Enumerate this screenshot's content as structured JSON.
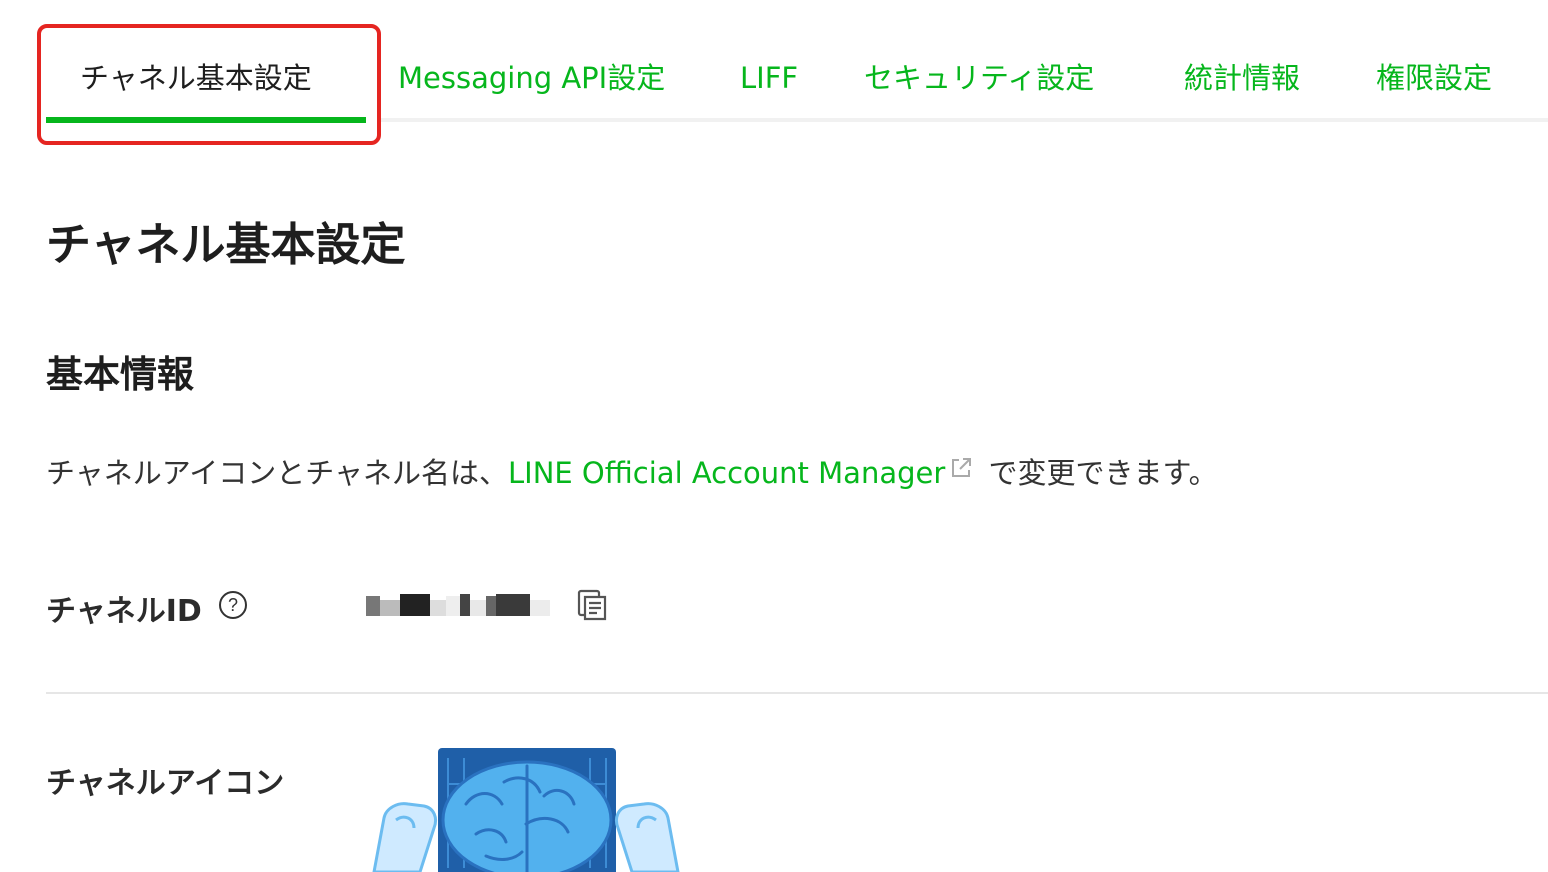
{
  "tabs": [
    {
      "label": "チャネル基本設定",
      "active": true
    },
    {
      "label": "Messaging API設定",
      "active": false
    },
    {
      "label": "LIFF",
      "active": false
    },
    {
      "label": "セキュリティ設定",
      "active": false
    },
    {
      "label": "統計情報",
      "active": false
    },
    {
      "label": "権限設定",
      "active": false
    }
  ],
  "page_title": "チャネル基本設定",
  "section_title": "基本情報",
  "description": {
    "before": "チャネルアイコンとチャネル名は、",
    "link_text": "LINE Official Account Manager",
    "after": " で変更できます。"
  },
  "fields": {
    "channel_id_label": "チャネルID",
    "channel_icon_label": "チャネルアイコン"
  },
  "icons": [
    "help-circle-icon",
    "copy-icon",
    "external-link-icon"
  ],
  "colors": {
    "accent": "#06b61c",
    "highlight": "#e52521",
    "text": "#1e1e1e"
  }
}
